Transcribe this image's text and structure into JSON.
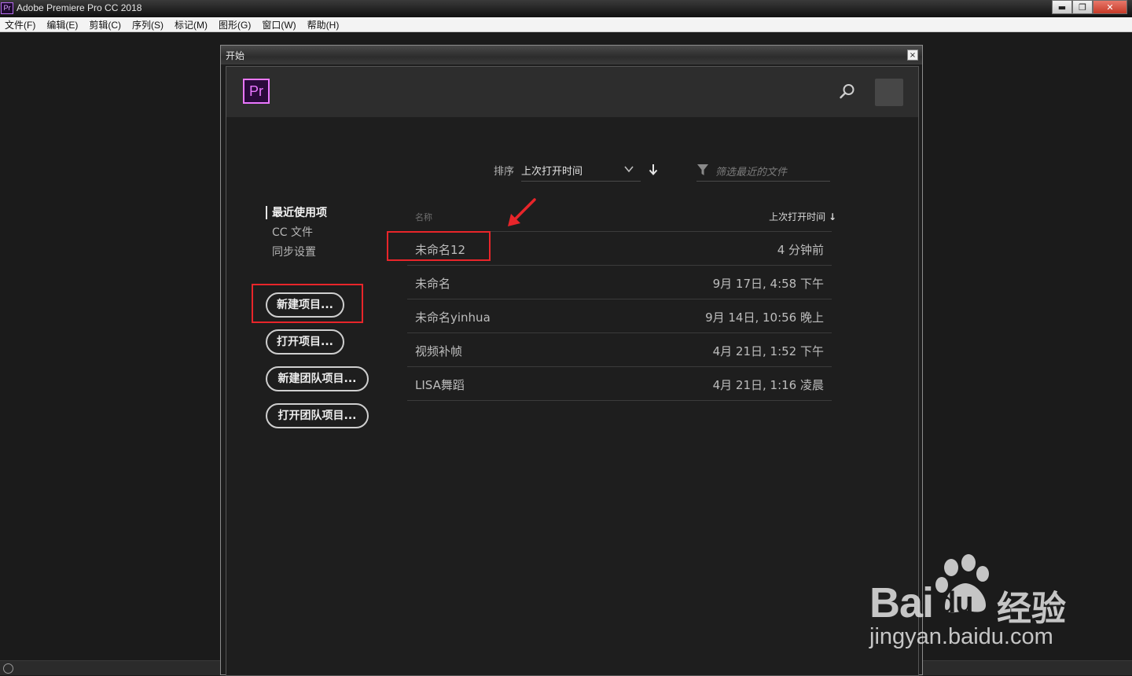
{
  "window": {
    "title": "Adobe Premiere Pro CC 2018",
    "app_icon": "Pr"
  },
  "window_controls": {
    "minimize": "▬",
    "restore": "❐",
    "close": "✕"
  },
  "menu": [
    "文件(F)",
    "编辑(E)",
    "剪辑(C)",
    "序列(S)",
    "标记(M)",
    "图形(G)",
    "窗口(W)",
    "帮助(H)"
  ],
  "dialog": {
    "title": "开始",
    "close": "×",
    "logo": "Pr",
    "sort": {
      "label": "排序",
      "value": "上次打开时间"
    },
    "filter": {
      "placeholder": "筛选最近的文件"
    },
    "nav": [
      "最近使用项",
      "CC 文件",
      "同步设置"
    ],
    "buttons": {
      "new_project": "新建项目...",
      "open_project": "打开项目...",
      "new_team_project": "新建团队项目...",
      "open_team_project": "打开团队项目..."
    },
    "list": {
      "col_name": "名称",
      "col_time": "上次打开时间",
      "rows": [
        {
          "name": "未命名12",
          "time": "4 分钟前"
        },
        {
          "name": "未命名",
          "time": "9月 17日, 4:58 下午"
        },
        {
          "name": "未命名yinhua",
          "time": "9月 14日, 10:56 晚上"
        },
        {
          "name": "视频补帧",
          "time": "4月 21日, 1:52 下午"
        },
        {
          "name": "LISA舞蹈",
          "time": "4月 21日, 1:16 凌晨"
        }
      ]
    }
  },
  "watermark": {
    "brand": "Bai",
    "brand_du": "du",
    "cn": "经验",
    "url": "jingyan.baidu.com"
  },
  "colors": {
    "accent": "#ea77ff",
    "highlight": "#e8252a"
  }
}
